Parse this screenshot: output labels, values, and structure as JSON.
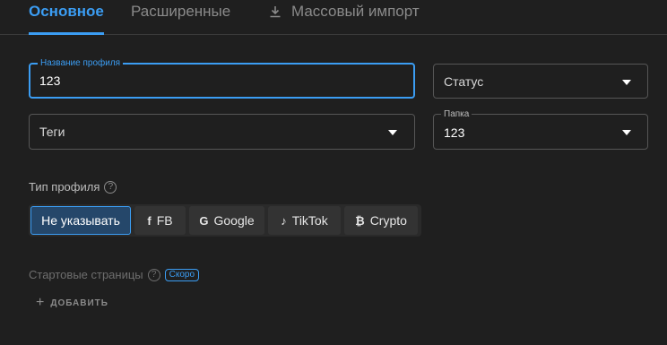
{
  "tabs": [
    {
      "label": "Основное",
      "active": true
    },
    {
      "label": "Расширенные",
      "active": false
    },
    {
      "label": "Массовый импорт",
      "active": false,
      "icon": "download-icon"
    }
  ],
  "form": {
    "profile_name": {
      "label": "Название профиля",
      "value": "123"
    },
    "status": {
      "placeholder": "Статус"
    },
    "tags": {
      "placeholder": "Теги"
    },
    "folder": {
      "label": "Папка",
      "value": "123"
    }
  },
  "profile_type": {
    "label": "Тип профиля",
    "options": [
      {
        "label": "Не указывать",
        "selected": true,
        "icon": ""
      },
      {
        "label": "FB",
        "icon": "facebook-icon"
      },
      {
        "label": "Google",
        "icon": "google-icon"
      },
      {
        "label": "TikTok",
        "icon": "tiktok-icon"
      },
      {
        "label": "Crypto",
        "icon": "bitcoin-icon"
      }
    ]
  },
  "start_pages": {
    "label": "Стартовые страницы",
    "badge": "Скоро",
    "add_label": "ДОБАВИТЬ"
  },
  "colors": {
    "accent": "#3b9df3",
    "background": "#1f1f1f"
  }
}
